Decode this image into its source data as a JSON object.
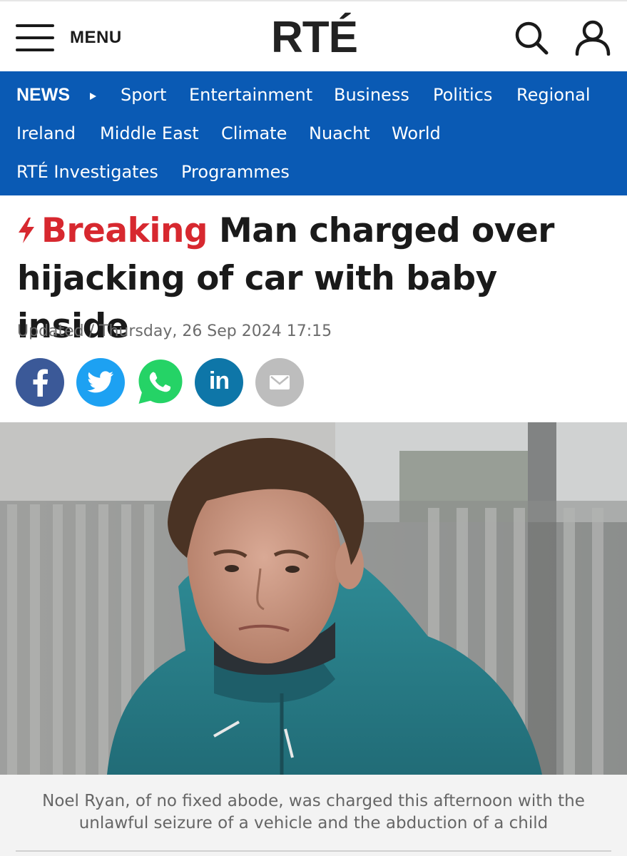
{
  "header": {
    "menu_label": "MENU",
    "logo_text": "RTÉ",
    "icons": [
      "search-icon",
      "user-icon"
    ]
  },
  "nav": {
    "background": "#0a5ab4",
    "section": "NEWS",
    "items": [
      "Sport",
      "Entertainment",
      "Business",
      "Politics",
      "Regional",
      "Ireland",
      "Middle East",
      "Climate",
      "Nuacht",
      "World",
      "RTÉ Investigates",
      "Programmes"
    ]
  },
  "article": {
    "breaking_label": "Breaking",
    "breaking_color": "#d7282f",
    "headline_line1": "Man charged over",
    "headline_line2": "hijacking of car with baby inside",
    "updated": "Updated / Thursday, 26 Sep 2024 17:15"
  },
  "share": [
    {
      "name": "facebook",
      "icon": "facebook-icon",
      "color": "#3b5998"
    },
    {
      "name": "twitter",
      "icon": "twitter-icon",
      "color": "#1da1f2"
    },
    {
      "name": "whatsapp",
      "icon": "whatsapp-icon",
      "color": "#25d366"
    },
    {
      "name": "linkedin",
      "icon": "linkedin-icon",
      "color": "#0e76a8"
    },
    {
      "name": "email",
      "icon": "email-icon",
      "color": "#bdbdbd"
    }
  ],
  "photo": {
    "caption_line1": "Noel Ryan, of no fixed abode, was charged this afternoon with the",
    "caption_line2": "unlawful seizure of a vehicle and the abduction of a child"
  }
}
